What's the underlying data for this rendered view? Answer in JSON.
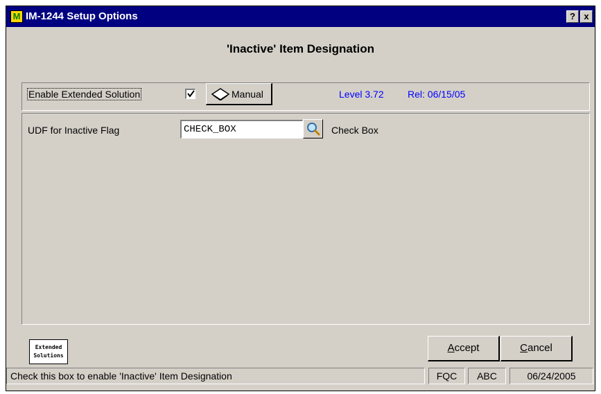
{
  "window": {
    "title": "IM-1244 Setup Options",
    "help_glyph": "?",
    "close_glyph": "x",
    "app_icon": "M"
  },
  "heading": "'Inactive' Item Designation",
  "extended_solution": {
    "label": "Enable Extended Solution",
    "checked": true,
    "manual_button": "Manual",
    "level": "Level 3.72",
    "release": "Rel: 06/15/05"
  },
  "udf": {
    "label": "UDF for Inactive Flag",
    "value": "CHECK_BOX",
    "description": "Check Box"
  },
  "logo": {
    "line1": "Extended",
    "line2": "Solutions"
  },
  "buttons": {
    "accept_first": "A",
    "accept_rest": "ccept",
    "cancel_first": "C",
    "cancel_rest": "ancel"
  },
  "status": {
    "message": "Check this box to enable 'Inactive' Item Designation",
    "company": "FQC",
    "user": "ABC",
    "date": "06/24/2005"
  },
  "colors": {
    "titlebar": "#000080",
    "face": "#d4d0c8",
    "link_blue": "#0000ff"
  }
}
